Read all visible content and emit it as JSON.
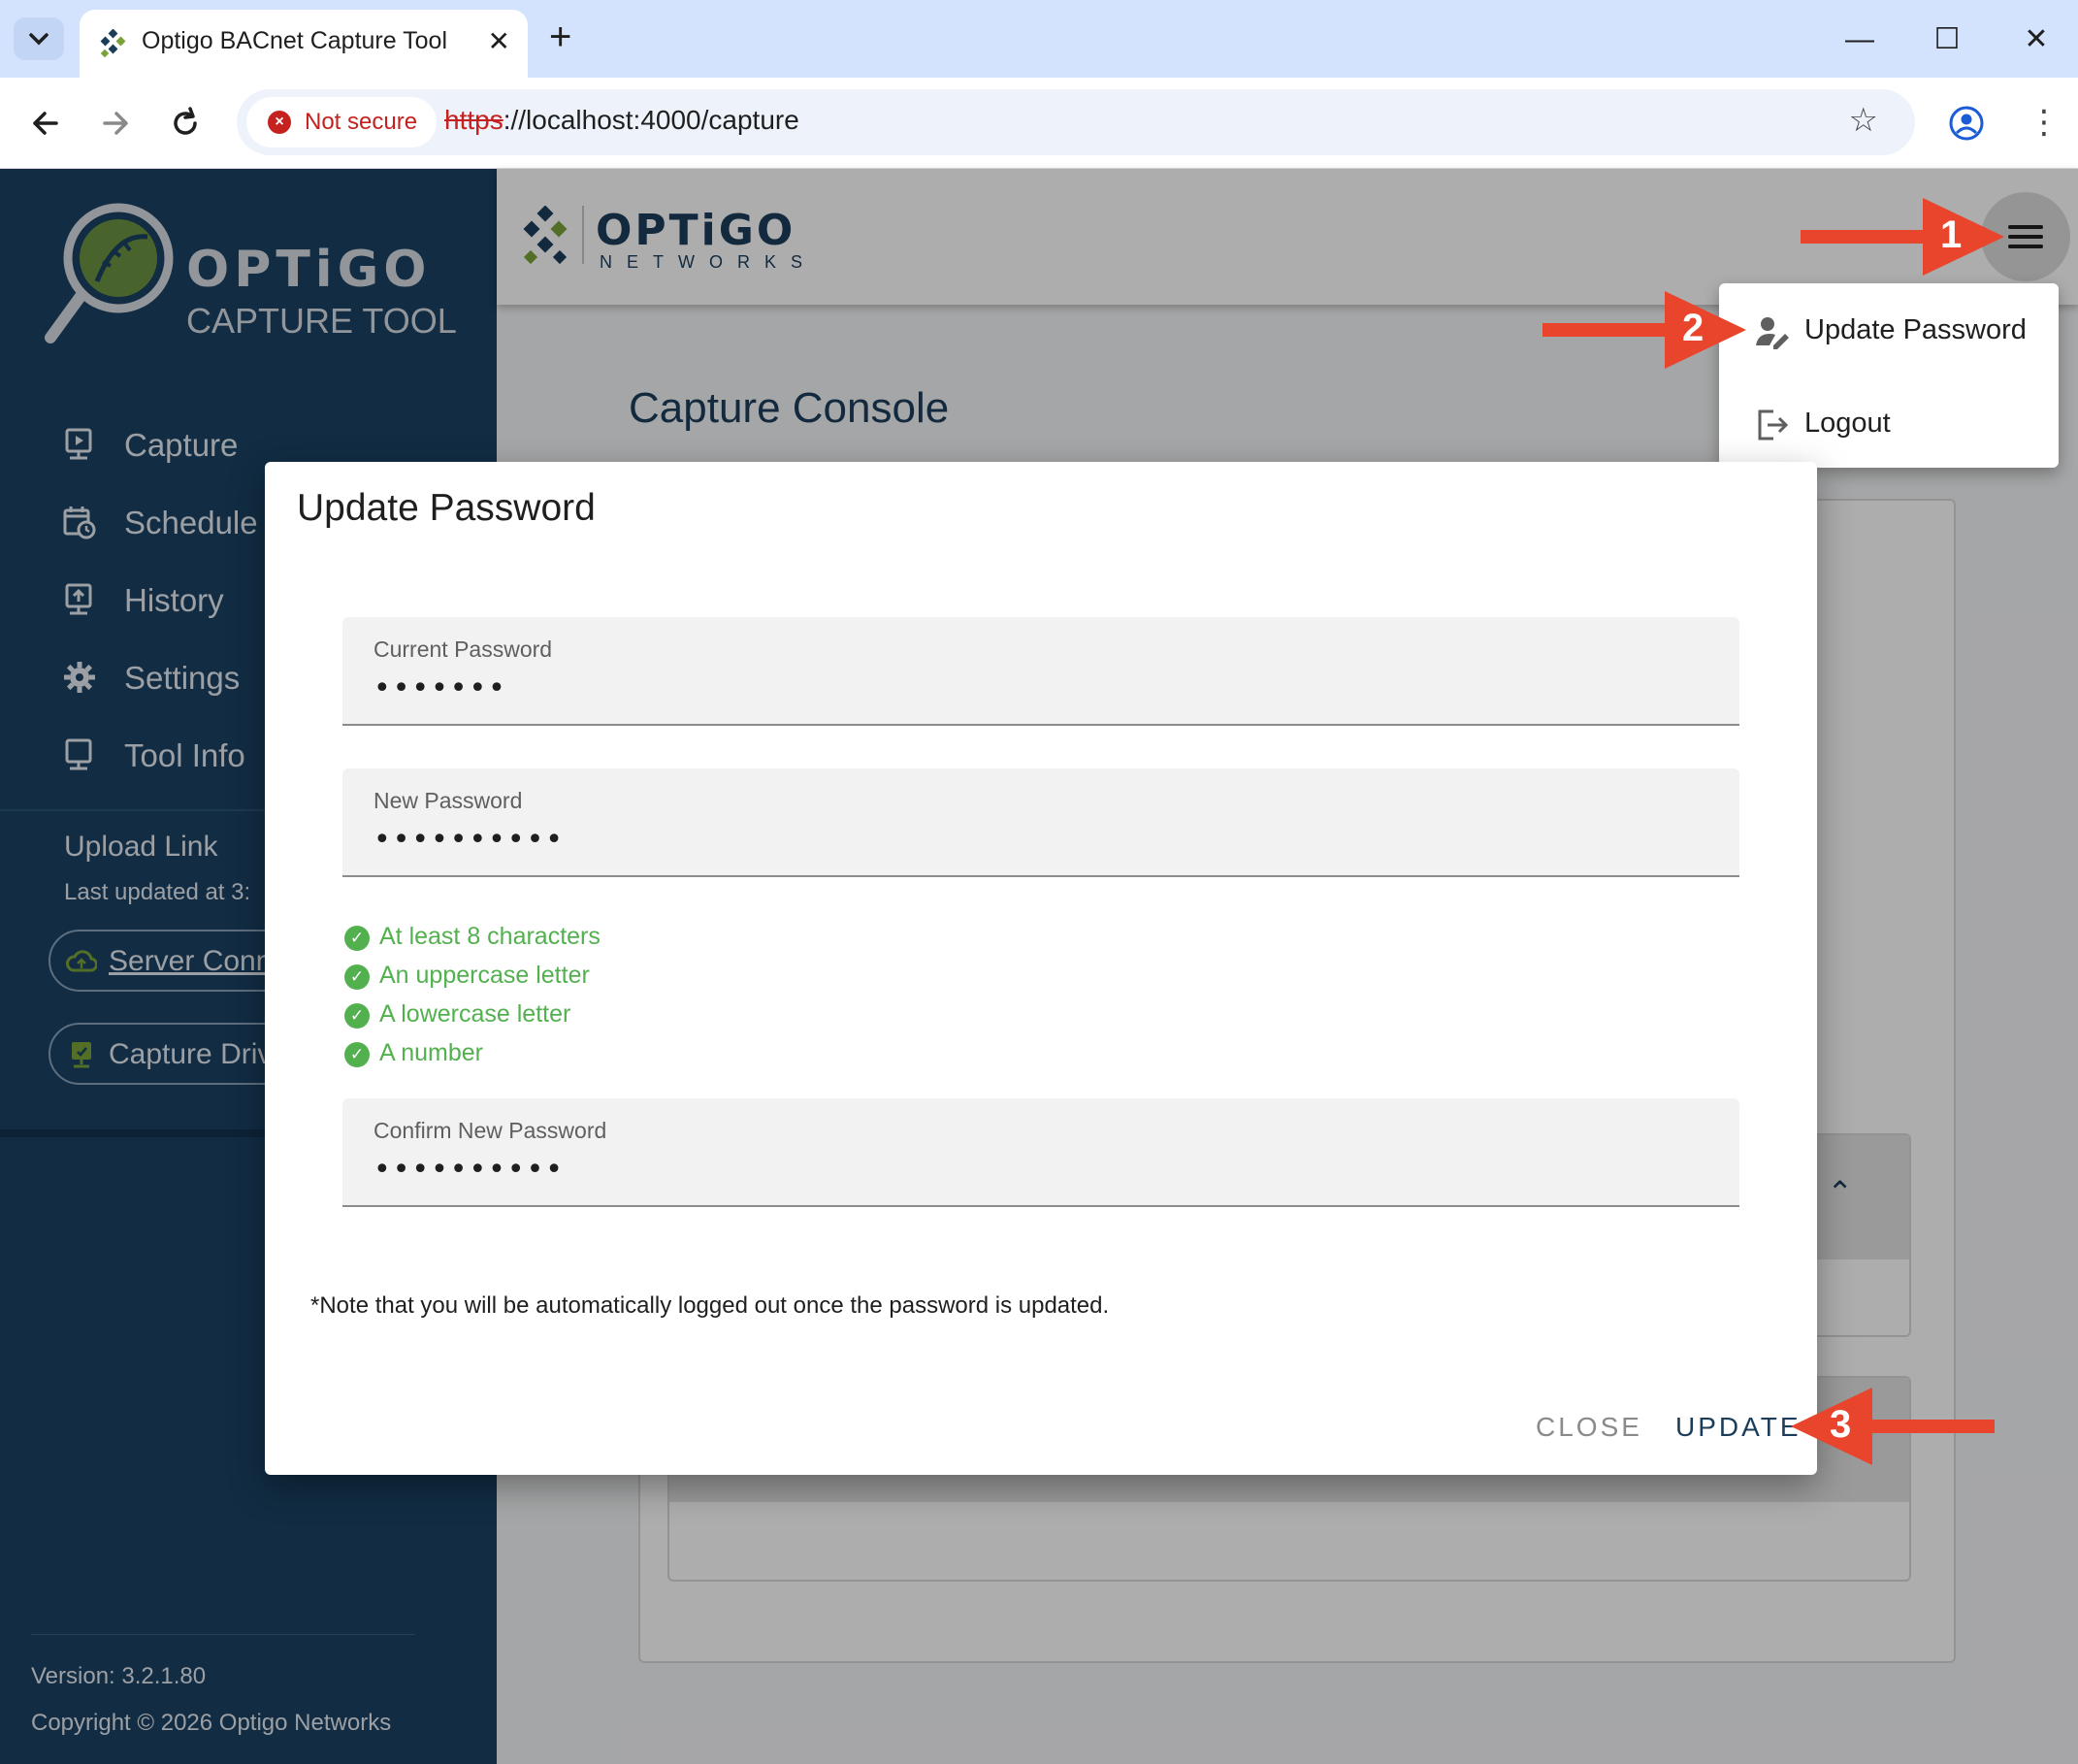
{
  "browser": {
    "tab_title": "Optigo BACnet Capture Tool",
    "close_tab_glyph": "✕",
    "new_tab_glyph": "+",
    "minimize_glyph": "—",
    "maximize_glyph": "☐",
    "close_window_glyph": "✕",
    "security_label": "Not secure",
    "url_scheme": "https",
    "url_rest": "://localhost:4000/capture",
    "bookmark_glyph": "☆",
    "menu_glyph": "⋮",
    "icons": [
      "tab-list-icon",
      "back-icon",
      "forward-icon",
      "reload-icon",
      "not-secure-icon",
      "star-icon",
      "profile-icon",
      "kebab-menu-icon"
    ]
  },
  "sidebar": {
    "brand_name": "OPTiGO",
    "brand_product": "CAPTURE TOOL",
    "items": [
      {
        "label": "Capture",
        "icon": "capture-icon"
      },
      {
        "label": "Schedule",
        "icon": "calendar-clock-icon"
      },
      {
        "label": "History",
        "icon": "history-upload-icon"
      },
      {
        "label": "Settings",
        "icon": "gear-icon"
      },
      {
        "label": "Tool Info",
        "icon": "monitor-icon"
      }
    ],
    "upload_link_title": "Upload Link",
    "upload_link_updated": "Last updated at 3:",
    "server_connection_label": "Server Conne",
    "capture_drive_label": "Capture Driv",
    "version": "Version: 3.2.1.80",
    "copyright": "Copyright © 2026 Optigo Networks"
  },
  "appbar": {
    "logo_name": "OPTiGO",
    "logo_sub": "NETWORKS"
  },
  "main": {
    "page_title": "Capture Console",
    "accordion_chevron": "⌃"
  },
  "user_menu": {
    "items": [
      {
        "label": "Update Password",
        "icon": "user-edit-icon"
      },
      {
        "label": "Logout",
        "icon": "logout-icon"
      }
    ]
  },
  "dialog": {
    "title": "Update Password",
    "current_password_label": "Current Password",
    "current_password_value": "•••••••",
    "new_password_label": "New Password",
    "new_password_value": "••••••••••",
    "requirements": [
      "At least 8 characters",
      "An uppercase letter",
      "A lowercase letter",
      "A number"
    ],
    "check_glyph": "✓",
    "confirm_password_label": "Confirm New Password",
    "confirm_password_value": "••••••••••",
    "note": "*Note that you will be automatically logged out once the password is updated.",
    "close_label": "CLOSE",
    "update_label": "UPDATE"
  },
  "annotations": {
    "step1": "1",
    "step2": "2",
    "step3": "3",
    "color": "#e8452c"
  },
  "colors": {
    "sidebar_bg": "#1a4163",
    "brand_navy": "#1c3d5a",
    "tab_strip": "#d3e3fd",
    "success_green": "#53b04f",
    "insecure_red": "#c5221f"
  }
}
